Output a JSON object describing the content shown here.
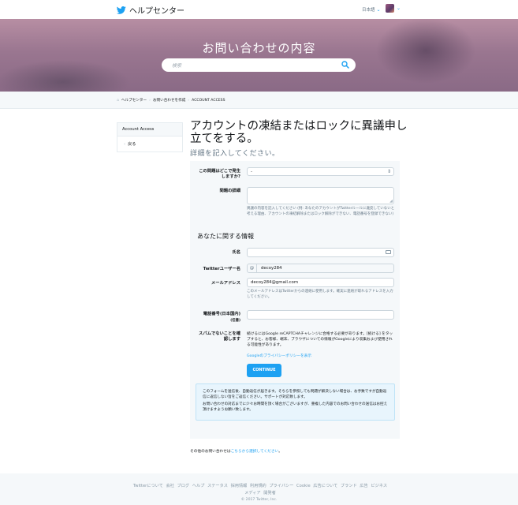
{
  "header": {
    "brand": "ヘルプセンター",
    "language": "日本語",
    "icons": {
      "logo": "twitter-bird-icon",
      "lang_chevron": "chevron-down-icon",
      "avatar": "user-avatar"
    }
  },
  "hero": {
    "title": "お問い合わせの内容",
    "search_placeholder": "検索"
  },
  "breadcrumb": [
    "ヘルプセンター",
    "お問い合わせを作成",
    "ACCOUNT ACCESS"
  ],
  "sidenav": {
    "heading": "Account Access",
    "back": "戻る"
  },
  "main": {
    "title": "アカウントの凍結またはロックに異議申し立てをする。",
    "subtitle": "詳細を記入してください。"
  },
  "form": {
    "where_label": "この問題はどこで発生しますか?",
    "where_value": "-",
    "details_label": "問題の詳細",
    "details_help": "異議の内容を記入してください (例: あなたのアカウントがTwitterルールに違反していないと考える理由、アカウントの凍結解除またはロック解除ができない、電話番号を登録できない)",
    "about_heading": "あなたに関する情報",
    "name_label": "氏名",
    "name_value": "",
    "username_label": "Twitterユーザー名",
    "username_value": "decoy284",
    "email_label": "メールアドレス",
    "email_value": "decoy284@gmail.com",
    "email_help": "このメールアドレスはTwitterからの連絡に使用します。確実に連絡が取れるアドレスを入力してください。",
    "phone_label": "電話番号(日本国内)",
    "phone_optional": "(任意)",
    "phone_value": "",
    "spam_label": "スパムでないことを確認します",
    "spam_text": "続けるにはGoogle reCAPTCHAチャレンジに合格する必要があります。[続ける] をタップすると、お客様、端末、ブラウザについての情報がGoogleにより収集および使用される可能性があります。",
    "privacy_link": "Googleのプライバシーポリシーを表示",
    "continue_button": "CONTINUE",
    "info_line1": "このフォームを送信後、自動返信が届きます。そちらを参照しても問題が解決しない場合は、お手数ですが自動返信に返信しない旨をご返信ください。サポートが対応致します。",
    "info_line2": "お問い合わせの対応までに少々お時間を頂く場合がございますが、重複した内容でのお問い合わせの送信はお控え頂けますようお願い致します。"
  },
  "other": {
    "prefix": "その他のお問い合わせは",
    "link": "こちらから選択してください",
    "suffix": "。"
  },
  "footer": {
    "links_line1": "Twitterについて 会社 ブログ ヘルプ ステータス 採用情報 利用規約 プライバシー Cookie 広告について ブランド 広告 ビジネス",
    "links_line2": "メディア 開発者",
    "copyright": "© 2017 Twitter, Inc."
  }
}
